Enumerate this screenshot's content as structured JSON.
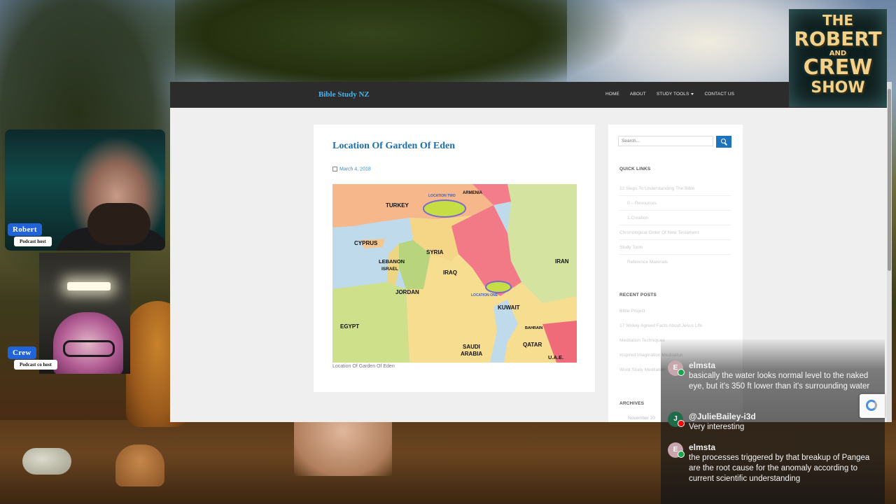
{
  "site": {
    "brand": "Bible Study NZ",
    "nav": [
      "HOME",
      "ABOUT",
      "STUDY TOOLS",
      "CONTACT US"
    ]
  },
  "post": {
    "title": "Location Of Garden Of Eden",
    "date": "March 4, 2018",
    "caption": "Location Of Garden Of Eden",
    "map_labels": {
      "turkey": "TURKEY",
      "cyprus": "CYPRUS",
      "syria": "SYRIA",
      "lebanon": "LEBANON",
      "israel": "ISRAEL",
      "jordan": "JORDAN",
      "iraq": "IRAQ",
      "iran": "IRAN",
      "kuwait": "KUWAIT",
      "egypt": "EGYPT",
      "saudi": "SAUDI",
      "arabia": "ARABIA",
      "qatar": "QATAR",
      "bahrain": "BAHRAIN",
      "uae": "U.A.E.",
      "armenia": "ARMENIA",
      "location_two": "LOCATION TWO",
      "location_one": "LOCATION ONE"
    }
  },
  "sidebar": {
    "search_placeholder": "Search...",
    "quick_links_heading": "QUICK LINKS",
    "quick_links": [
      "12 Steps To Understanding The Bible",
      "0 – Resources",
      "1.Creation",
      "Chronological Order Of New Testament",
      "Study Tools",
      "Reference Materials"
    ],
    "recent_posts_heading": "RECENT POSTS",
    "recent_posts": [
      "Bible Project",
      "17 Widely Agreed Facts About Jesus Life",
      "Meditation Techniques",
      "Inspired Imagination Meditation",
      "Word Study Meditation"
    ],
    "archives_heading": "ARCHIVES",
    "archives_first": "November 20"
  },
  "logo": {
    "line1": "THE",
    "line2": "ROBERT",
    "line3": "AND",
    "line4": "CREW",
    "line5": "SHOW"
  },
  "hosts": [
    {
      "name": "Robert",
      "role": "Podcast host"
    },
    {
      "name": "Crew",
      "role": "Podcast co host"
    }
  ],
  "chat": [
    {
      "initial": "E",
      "author": "elmsta",
      "text": "basically the water looks normal level to the naked eye, but it's 350 ft lower than it's surrounding water",
      "avatar_color": "#c7a7ad",
      "badge_color": "#19a34a"
    },
    {
      "initial": "J",
      "author": "@JulieBailey-i3d",
      "text": "Very interesting",
      "avatar_color": "#1f6b4a",
      "badge_color": "#ff0000"
    },
    {
      "initial": "E",
      "author": "elmsta",
      "text": "the processes triggered by that breakup of Pangea are the root cause for the anomaly according to current scientific understanding",
      "avatar_color": "#c7a7ad",
      "badge_color": "#19a34a"
    }
  ],
  "colors": {
    "accent": "#2164d9",
    "brand_link": "#4ab4ee",
    "title": "#1d6faa",
    "iraq": "#f27a86"
  }
}
